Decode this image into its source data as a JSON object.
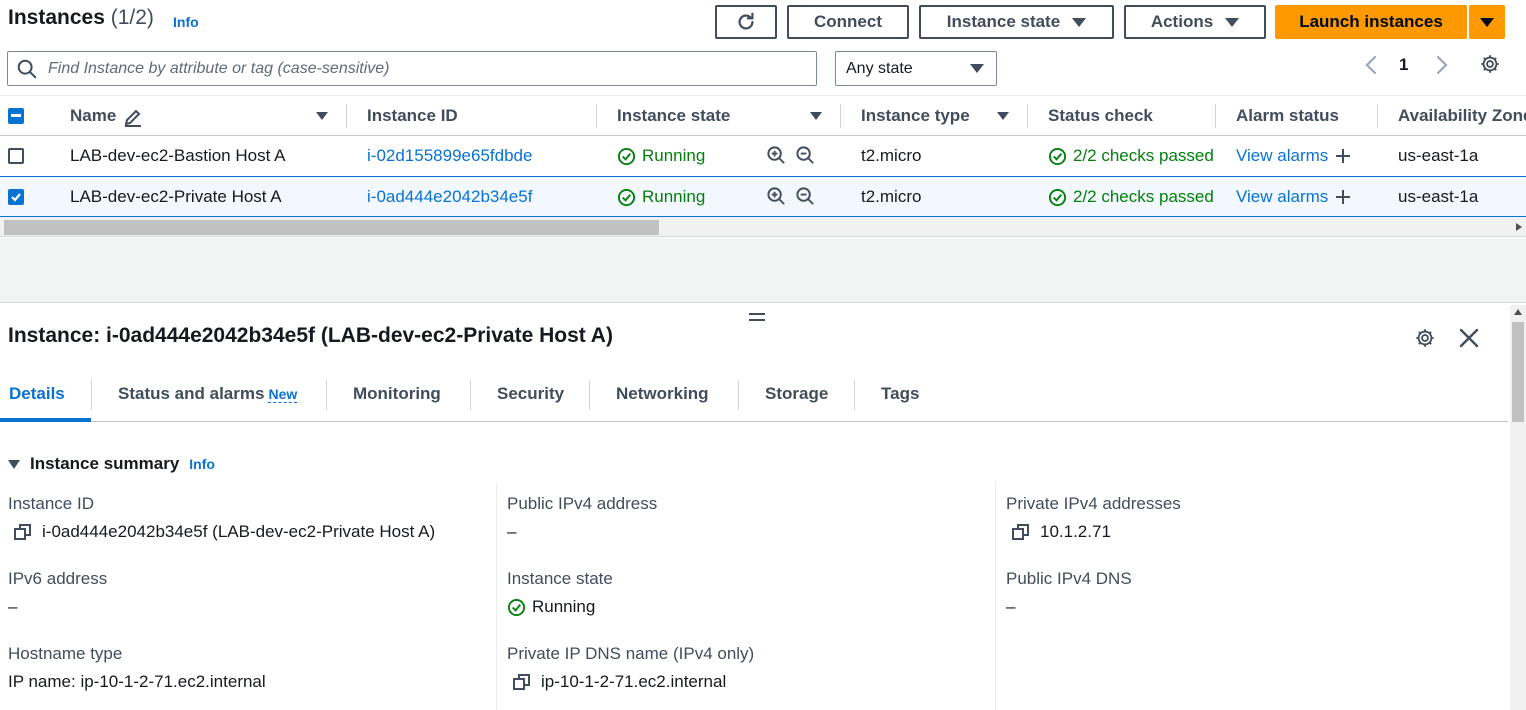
{
  "header": {
    "title": "Instances",
    "count": "(1/2)",
    "info": "Info",
    "buttons": {
      "connect": "Connect",
      "instance_state": "Instance state",
      "actions": "Actions",
      "launch": "Launch instances"
    }
  },
  "filter": {
    "search_placeholder": "Find Instance by attribute or tag (case-sensitive)",
    "state_value": "Any state",
    "page": "1"
  },
  "table": {
    "columns": [
      "Name",
      "Instance ID",
      "Instance state",
      "Instance type",
      "Status check",
      "Alarm status",
      "Availability Zone"
    ],
    "rows": [
      {
        "name": "LAB-dev-ec2-Bastion Host A",
        "id": "i-02d155899e65fdbde",
        "state": "Running",
        "type": "t2.micro",
        "status": "2/2 checks passed",
        "alarm": "View alarms",
        "az": "us-east-1a",
        "selected": false
      },
      {
        "name": "LAB-dev-ec2-Private Host A",
        "id": "i-0ad444e2042b34e5f",
        "state": "Running",
        "type": "t2.micro",
        "status": "2/2 checks passed",
        "alarm": "View alarms",
        "az": "us-east-1a",
        "selected": true
      }
    ]
  },
  "detail": {
    "title": "Instance: i-0ad444e2042b34e5f (LAB-dev-ec2-Private Host A)",
    "tabs": [
      "Details",
      "Status and alarms",
      "Monitoring",
      "Security",
      "Networking",
      "Storage",
      "Tags"
    ],
    "new_badge": "New",
    "summary": {
      "heading": "Instance summary",
      "info": "Info",
      "fields": {
        "instance_id_label": "Instance ID",
        "instance_id_value": "i-0ad444e2042b34e5f (LAB-dev-ec2-Private Host A)",
        "public_ipv4_label": "Public IPv4 address",
        "public_ipv4_value": "–",
        "private_ipv4_label": "Private IPv4 addresses",
        "private_ipv4_value": "10.1.2.71",
        "ipv6_label": "IPv6 address",
        "ipv6_value": "–",
        "state_label": "Instance state",
        "state_value": "Running",
        "public_dns_label": "Public IPv4 DNS",
        "public_dns_value": "–",
        "hostname_type_label": "Hostname type",
        "hostname_type_value": "IP name: ip-10-1-2-71.ec2.internal",
        "private_dns_label": "Private IP DNS name (IPv4 only)",
        "private_dns_value": "ip-10-1-2-71.ec2.internal"
      }
    }
  },
  "colors": {
    "accent": "#0972d3",
    "launch": "#ff9900",
    "success": "#037f0c"
  }
}
